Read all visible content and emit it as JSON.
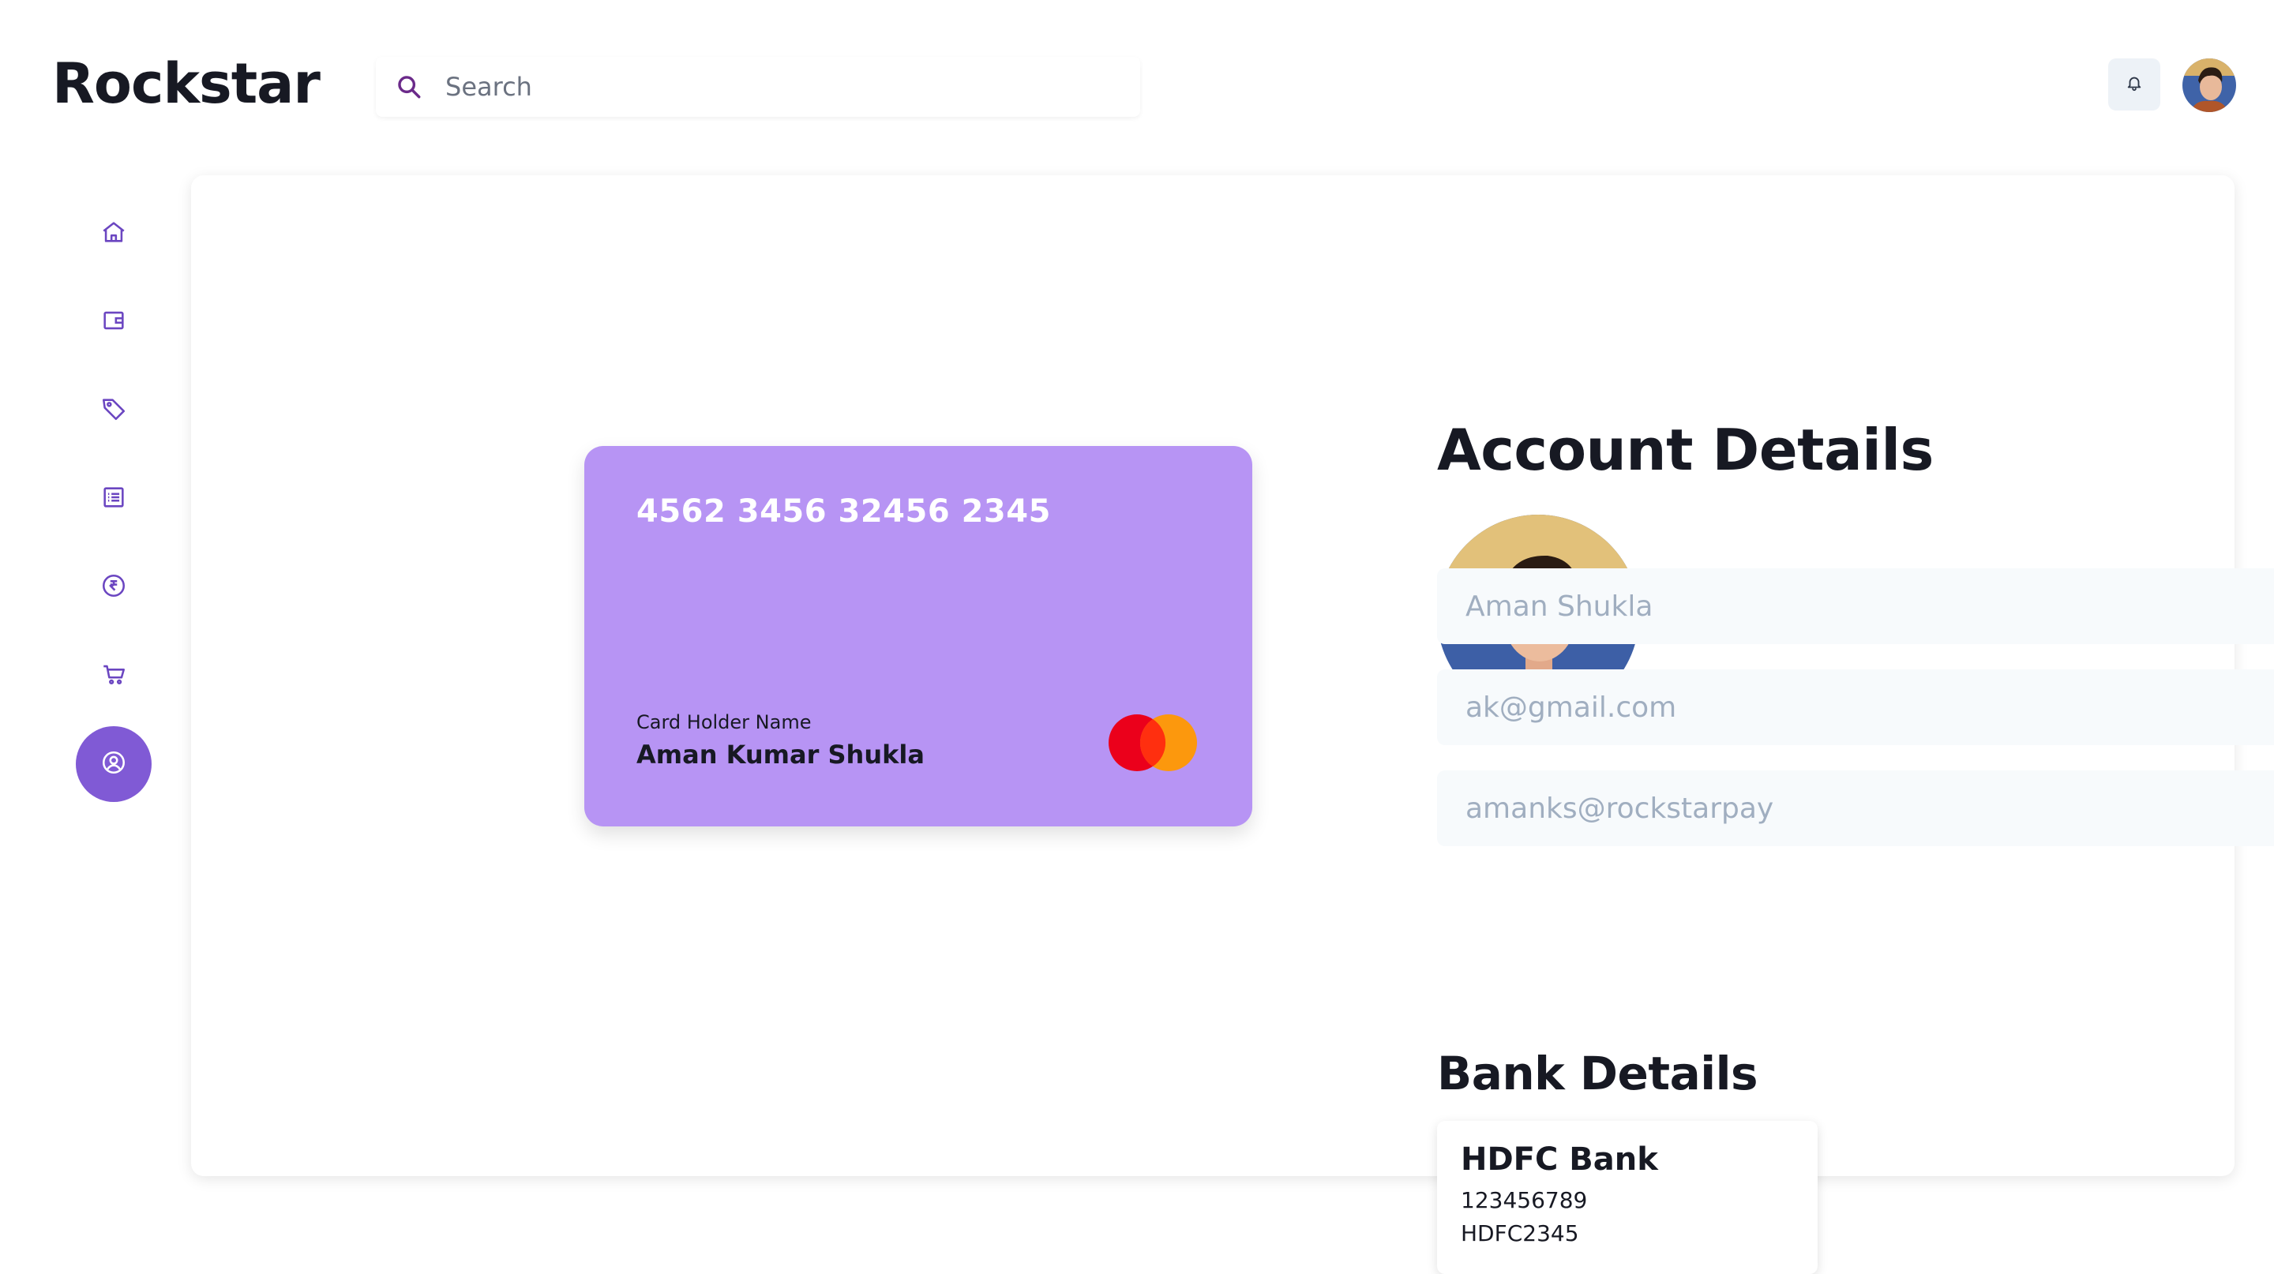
{
  "app": {
    "logo": "Rockstar"
  },
  "search": {
    "placeholder": "Search",
    "icon": "search-icon"
  },
  "header": {
    "notification_icon": "bell-icon",
    "avatar": "user-avatar"
  },
  "sidebar": {
    "items": [
      {
        "icon": "home-icon",
        "active": false
      },
      {
        "icon": "wallet-icon",
        "active": false
      },
      {
        "icon": "tag-icon",
        "active": false
      },
      {
        "icon": "list-icon",
        "active": false
      },
      {
        "icon": "rupee-icon",
        "active": false
      },
      {
        "icon": "cart-icon",
        "active": false
      },
      {
        "icon": "user-circle-icon",
        "active": true
      }
    ]
  },
  "card": {
    "number": "4562 3456 32456 2345",
    "holder_label": "Card Holder Name",
    "holder_name": "Aman Kumar Shukla",
    "color": "#b794f4",
    "network_icon": "mastercard-icon"
  },
  "account": {
    "title": "Account Details",
    "name_placeholder": "Aman Shukla",
    "email_placeholder": "ak@gmail.com",
    "upi_placeholder": "amanks@rockstarpay"
  },
  "bank": {
    "title": "Bank Details",
    "name": "HDFC Bank",
    "account_number": "123456789",
    "ifsc": "HDFC2345"
  },
  "colors": {
    "accent": "#805ad5",
    "text": "#171923",
    "field_bg": "#f7fafc",
    "placeholder": "#a0aec0"
  }
}
